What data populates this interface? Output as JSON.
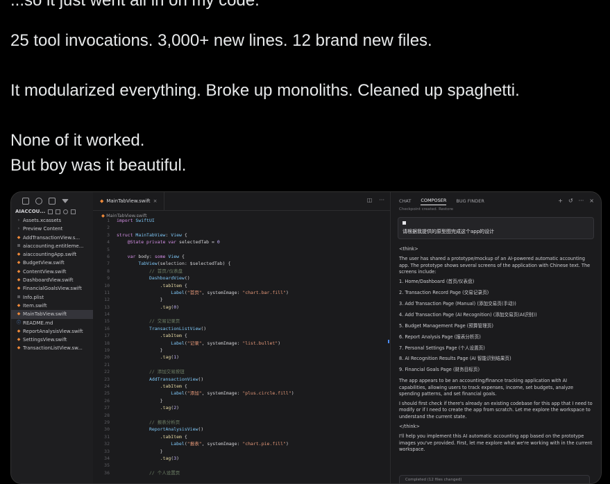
{
  "tweet": {
    "cutoff_line": "...so it just went all in on my code.",
    "line1": "25 tool invocations. 3,000+ new lines. 12 brand new files.",
    "line2": "It modularized everything. Broke up monoliths. Cleaned up spaghetti.",
    "line3": "None of it worked.",
    "line4": "But boy was it beautiful."
  },
  "sidebar": {
    "project_name": "AIACCOU...",
    "items": [
      {
        "label": "Assets.xcassets",
        "icon": "folder-icon"
      },
      {
        "label": "Preview Content",
        "icon": "folder-icon"
      },
      {
        "label": "AddTransactionView.s...",
        "icon": "swift-icon"
      },
      {
        "label": "aiaccounting.entitleme...",
        "icon": "file-icon"
      },
      {
        "label": "aiaccountingApp.swift",
        "icon": "swift-icon"
      },
      {
        "label": "BudgetView.swift",
        "icon": "swift-icon"
      },
      {
        "label": "ContentView.swift",
        "icon": "swift-icon"
      },
      {
        "label": "DashboardView.swift",
        "icon": "swift-icon"
      },
      {
        "label": "FinancialGoalsView.swift",
        "icon": "swift-icon"
      },
      {
        "label": "Info.plist",
        "icon": "file-icon"
      },
      {
        "label": "Item.swift",
        "icon": "swift-icon"
      },
      {
        "label": "MainTabView.swift",
        "icon": "swift-icon",
        "selected": true
      },
      {
        "label": "README.md",
        "icon": "info-icon"
      },
      {
        "label": "ReportAnalysisView.swift",
        "icon": "swift-icon"
      },
      {
        "label": "SettingsView.swift",
        "icon": "swift-icon"
      },
      {
        "label": "TransactionListView.sw...",
        "icon": "swift-icon"
      }
    ]
  },
  "editor": {
    "tab_label": "MainTabView.swift",
    "breadcrumb": "MainTabView.swift"
  },
  "chat": {
    "tabs": [
      "CHAT",
      "COMPOSER",
      "BUG FINDER"
    ],
    "active_tab": "COMPOSER",
    "checkpoint": "Checkpoint created. Restore",
    "prompt": "请根据我提供的原型图完成这个app的设计",
    "think_open": "<think>",
    "intro": "The user has shared a prototype/mockup of an AI-powered automatic accounting app. The prototype shows several screens of the application with Chinese text. The screens include:",
    "pages": [
      "1. Home/Dashboard (首页/仪表盘)",
      "2. Transaction Record Page (交易记录页)",
      "3. Add Transaction Page (Manual) (添加交易页(手动))",
      "4. Add Transaction Page (AI Recognition) (添加交易页(AI识别))",
      "5. Budget Management Page (预算管理页)",
      "6. Report Analysis Page (报表分析页)",
      "7. Personal Settings Page (个人设置页)",
      "8. AI Recognition Results Page (AI 智能识别结果页)",
      "9. Financial Goals Page (财务目标页)"
    ],
    "para1": "The app appears to be an accounting/finance tracking application with AI capabilities, allowing users to track expenses, income, set budgets, analyze spending patterns, and set financial goals.",
    "para2": "I should first check if there's already an existing codebase for this app that I need to modify or if I need to create the app from scratch. Let me explore the workspace to understand the current state.",
    "think_close": "</think>",
    "para3": "I'll help you implement this AI automatic accounting app based on the prototype images you've provided. First, let me explore what we're working with in the current workspace.",
    "completed": "Completed (12 files changed)"
  },
  "code_lines": [
    {
      "n": "1",
      "html": "<span class='kw'>import</span> <span class='ty'>SwiftUI</span>"
    },
    {
      "n": "2",
      "html": ""
    },
    {
      "n": "3",
      "html": "<span class='kw'>struct</span> <span class='ty'>MainTabView</span><span class='pl'>: </span><span class='ty'>View</span><span class='pl'> {</span>"
    },
    {
      "n": "4",
      "html": "    <span class='kw'>@State private var</span> <span class='pl'>selectedTab = </span><span class='num'>0</span>"
    },
    {
      "n": "5",
      "html": ""
    },
    {
      "n": "6",
      "html": "    <span class='kw'>var</span> <span class='pl'>body: </span><span class='kw'>some</span> <span class='ty'>View</span><span class='pl'> {</span>"
    },
    {
      "n": "7",
      "html": "        <span class='ty'>TabView</span><span class='pl'>(selection: $selectedTab) {</span>"
    },
    {
      "n": "8",
      "html": "            <span class='cm'>// 首页/仪表盘</span>"
    },
    {
      "n": "9",
      "html": "            <span class='ty'>DashboardView</span><span class='pl'>()</span>"
    },
    {
      "n": "10",
      "html": "                <span class='fn'>.tabItem</span><span class='pl'> {</span>"
    },
    {
      "n": "11",
      "html": "                    <span class='ty'>Label</span><span class='pl'>(</span><span class='str'>\"首页\"</span><span class='pl'>, systemImage: </span><span class='str'>\"chart.bar.fill\"</span><span class='pl'>)</span>"
    },
    {
      "n": "12",
      "html": "                <span class='pl'>}</span>"
    },
    {
      "n": "13",
      "html": "                <span class='fn'>.tag</span><span class='pl'>(</span><span class='num'>0</span><span class='pl'>)</span>"
    },
    {
      "n": "14",
      "html": ""
    },
    {
      "n": "15",
      "html": "            <span class='cm'>// 交易记录页</span>"
    },
    {
      "n": "16",
      "html": "            <span class='ty'>TransactionListView</span><span class='pl'>()</span>"
    },
    {
      "n": "17",
      "html": "                <span class='fn'>.tabItem</span><span class='pl'> {</span>"
    },
    {
      "n": "18",
      "html": "                    <span class='ty'>Label</span><span class='pl'>(</span><span class='str'>\"记录\"</span><span class='pl'>, systemImage: </span><span class='str'>\"list.bullet\"</span><span class='pl'>)</span>"
    },
    {
      "n": "19",
      "html": "                <span class='pl'>}</span>"
    },
    {
      "n": "20",
      "html": "                <span class='fn'>.tag</span><span class='pl'>(</span><span class='num'>1</span><span class='pl'>)</span>"
    },
    {
      "n": "21",
      "html": ""
    },
    {
      "n": "22",
      "html": "            <span class='cm'>// 添加交易按钮</span>"
    },
    {
      "n": "23",
      "html": "            <span class='ty'>AddTransactionView</span><span class='pl'>()</span>"
    },
    {
      "n": "24",
      "html": "                <span class='fn'>.tabItem</span><span class='pl'> {</span>"
    },
    {
      "n": "25",
      "html": "                    <span class='ty'>Label</span><span class='pl'>(</span><span class='str'>\"添加\"</span><span class='pl'>, systemImage: </span><span class='str'>\"plus.circle.fill\"</span><span class='pl'>)</span>"
    },
    {
      "n": "26",
      "html": "                <span class='pl'>}</span>"
    },
    {
      "n": "27",
      "html": "                <span class='fn'>.tag</span><span class='pl'>(</span><span class='num'>2</span><span class='pl'>)</span>"
    },
    {
      "n": "28",
      "html": ""
    },
    {
      "n": "29",
      "html": "            <span class='cm'>// 报表分析页</span>"
    },
    {
      "n": "30",
      "html": "            <span class='ty'>ReportAnalysisView</span><span class='pl'>()</span>"
    },
    {
      "n": "31",
      "html": "                <span class='fn'>.tabItem</span><span class='pl'> {</span>"
    },
    {
      "n": "32",
      "html": "                    <span class='ty'>Label</span><span class='pl'>(</span><span class='str'>\"报表\"</span><span class='pl'>, systemImage: </span><span class='str'>\"chart.pie.fill\"</span><span class='pl'>)</span>"
    },
    {
      "n": "33",
      "html": "                <span class='pl'>}</span>"
    },
    {
      "n": "34",
      "html": "                <span class='fn'>.tag</span><span class='pl'>(</span><span class='num'>3</span><span class='pl'>)</span>"
    },
    {
      "n": "35",
      "html": ""
    },
    {
      "n": "36",
      "html": "            <span class='cm'>// 个人设置页</span>"
    }
  ]
}
